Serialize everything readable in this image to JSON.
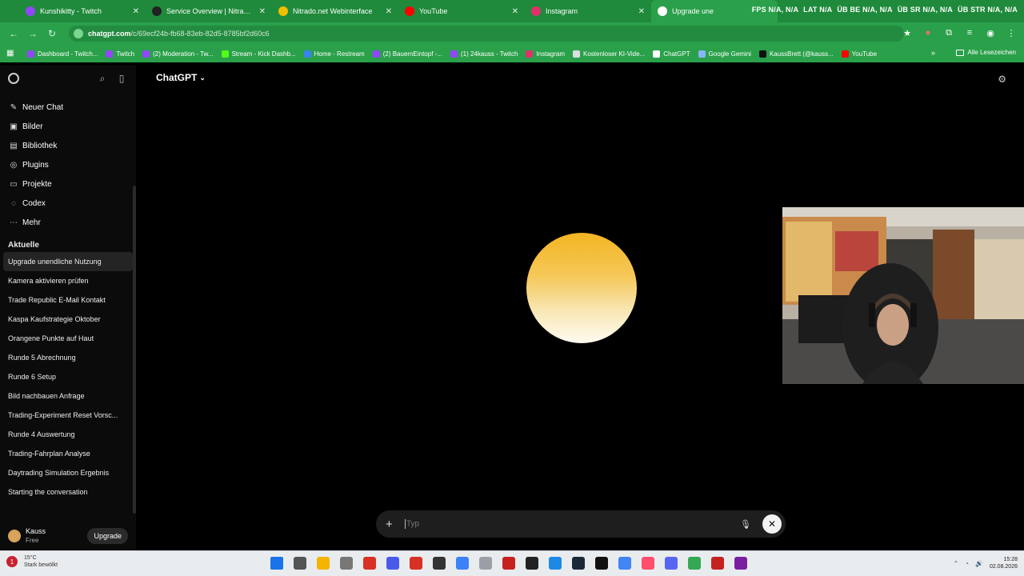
{
  "tabs": [
    {
      "title": "Kunshikitty - Twitch",
      "color": "#9146ff"
    },
    {
      "title": "Service Overview | Nitrado | Ni",
      "color": "#222222"
    },
    {
      "title": "Nitrado.net Webinterface",
      "color": "#f0c000"
    },
    {
      "title": "YouTube",
      "color": "#ff0000"
    },
    {
      "title": "Instagram",
      "color": "#e1306c"
    },
    {
      "title": "Upgrade une",
      "color": "#ffffff"
    }
  ],
  "hud": [
    "FPS N/A, N/A",
    "LAT N/A",
    "ÜB BE N/A, N/A",
    "ÜB SR N/A, N/A",
    "ÜB STR N/A, N/A"
  ],
  "address": {
    "host": "chatgpt.com",
    "path": "/c/69ecf24b-fb68-83eb-82d5-8785bf2d60c6"
  },
  "bookmarks": [
    {
      "label": "Dashboard - Twitch...",
      "color": "#9146ff"
    },
    {
      "label": "Twitch",
      "color": "#9146ff"
    },
    {
      "label": "(2) Moderation - Tw...",
      "color": "#9146ff"
    },
    {
      "label": "Stream - Kick Dashb...",
      "color": "#53fc18"
    },
    {
      "label": "Home - Restream",
      "color": "#3b82f6"
    },
    {
      "label": "(2) BauernEintopf -...",
      "color": "#9146ff"
    },
    {
      "label": "(1) 24kauss - Twitch",
      "color": "#9146ff"
    },
    {
      "label": "Instagram",
      "color": "#e1306c"
    },
    {
      "label": "Kostenloser KI-Vide...",
      "color": "#dddddd"
    },
    {
      "label": "ChatGPT",
      "color": "#ffffff"
    },
    {
      "label": "Google Gemini",
      "color": "#8ab4f8"
    },
    {
      "label": "KaussBrett (@kauss...",
      "color": "#111111"
    },
    {
      "label": "YouTube",
      "color": "#ff0000"
    }
  ],
  "bookmarks_all": "Alle Lesezeichen",
  "sidebar": {
    "menu": [
      {
        "label": "Neuer Chat",
        "icon": "✎"
      },
      {
        "label": "Bilder",
        "icon": "▣"
      },
      {
        "label": "Bibliothek",
        "icon": "▤"
      },
      {
        "label": "Plugins",
        "icon": "◎"
      },
      {
        "label": "Projekte",
        "icon": "▭"
      },
      {
        "label": "Codex",
        "icon": "◌"
      },
      {
        "label": "Mehr",
        "icon": "⋯"
      }
    ],
    "section": "Aktuelle",
    "chats": [
      "Upgrade unendliche Nutzung",
      "Kamera aktivieren prüfen",
      "Trade Republic E-Mail Kontakt",
      "Kaspa Kaufstrategie Oktober",
      "Orangene Punkte auf Haut",
      "Runde 5 Abrechnung",
      "Runde 6 Setup",
      "Bild nachbauen Anfrage",
      "Trading-Experiment Reset Vorsc...",
      "Runde 4 Auswertung",
      "Trading-Fahrplan Analyse",
      "Daytrading Simulation Ergebnis",
      "Starting the conversation"
    ],
    "user": {
      "name": "Kauss",
      "plan": "Free"
    },
    "upgrade": "Upgrade"
  },
  "main": {
    "model": "ChatGPT",
    "composer_placeholder": "Typ"
  },
  "taskbar": {
    "weather_temp": "15°C",
    "weather_text": "Stark bewölkt",
    "icon_colors": [
      "#1a73e8",
      "#555555",
      "#f4b400",
      "#777777",
      "#d93025",
      "#4a5ae8",
      "#d93025",
      "#333333",
      "#3b82f6",
      "#9aa0a6",
      "#c5221f",
      "#222222",
      "#1e88e5",
      "#1b2838",
      "#111111",
      "#4285f4",
      "#ff4f6d",
      "#5865f2",
      "#34a853",
      "#c5221f",
      "#7b1fa2"
    ],
    "time": "15:28",
    "date": "02.08.2026"
  }
}
